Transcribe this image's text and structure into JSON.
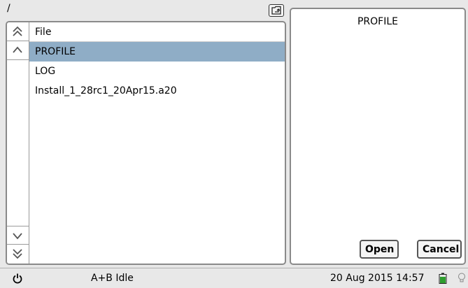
{
  "path": "/",
  "icons": {
    "up_dir": "folder-up-icon",
    "scroll_first": "double-chevron-up-icon",
    "scroll_prev": "chevron-up-icon",
    "scroll_next": "chevron-down-icon",
    "scroll_last": "double-chevron-down-icon",
    "power": "power-icon",
    "battery": "battery-icon",
    "bulb": "lightbulb-icon"
  },
  "list": {
    "header": "File",
    "items": [
      {
        "name": "PROFILE",
        "selected": true
      },
      {
        "name": "LOG",
        "selected": false
      },
      {
        "name": "Install_1_28rc1_20Apr15.a20",
        "selected": false
      }
    ]
  },
  "preview": {
    "title": "PROFILE",
    "open_label": "Open",
    "cancel_label": "Cancel"
  },
  "status": {
    "state": "A+B Idle",
    "datetime": "20 Aug 2015 14:57"
  },
  "colors": {
    "selection": "#8fadc6",
    "battery": "#2e9e2e"
  }
}
